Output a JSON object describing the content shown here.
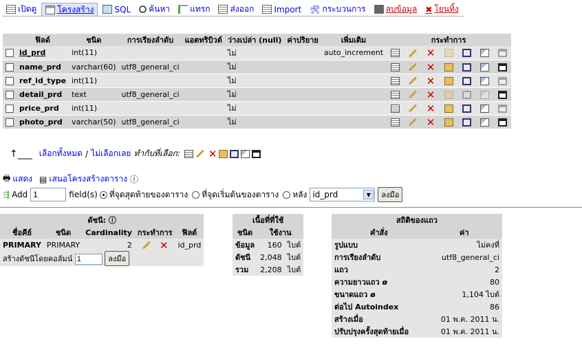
{
  "tabs": [
    {
      "label": "เปิดดู",
      "icon": "browse-icon"
    },
    {
      "label": "โครงสร้าง",
      "icon": "structure-icon",
      "active": true
    },
    {
      "label": "SQL",
      "icon": "sql-icon"
    },
    {
      "label": "ค้นหา",
      "icon": "search-icon"
    },
    {
      "label": "แทรก",
      "icon": "insert-icon"
    },
    {
      "label": "ส่งออก",
      "icon": "export-icon"
    },
    {
      "label": "Import",
      "icon": "import-icon"
    },
    {
      "label": "กระบวนการ",
      "icon": "operations-icon"
    },
    {
      "label": "ลบข้อมูล",
      "icon": "empty-icon",
      "warn": true
    },
    {
      "label": "โยนทิ้ง",
      "icon": "drop-icon",
      "warn": true
    }
  ],
  "fields_table": {
    "headers": [
      "ฟิลด์",
      "ชนิด",
      "การเรียงลำดับ",
      "แอตทริบิวต์",
      "ว่างเปล่า (null)",
      "ค่าปริยาย",
      "เพิ่มเติม",
      "กระทำการ"
    ],
    "rows": [
      {
        "name": "id_prd",
        "type": "int(11)",
        "collation": "",
        "attributes": "",
        "null": "ไม่",
        "default": "",
        "extra": "auto_increment",
        "primary": true
      },
      {
        "name": "name_prd",
        "type": "varchar(60)",
        "collation": "utf8_general_ci",
        "attributes": "",
        "null": "ไม่",
        "default": "",
        "extra": ""
      },
      {
        "name": "ref_id_type",
        "type": "int(11)",
        "collation": "",
        "attributes": "",
        "null": "ไม่",
        "default": "",
        "extra": ""
      },
      {
        "name": "detail_prd",
        "type": "text",
        "collation": "utf8_general_ci",
        "attributes": "",
        "null": "ไม่",
        "default": "",
        "extra": ""
      },
      {
        "name": "price_prd",
        "type": "int(11)",
        "collation": "",
        "attributes": "",
        "null": "ไม่",
        "default": "",
        "extra": ""
      },
      {
        "name": "photo_prd",
        "type": "varchar(50)",
        "collation": "utf8_general_ci",
        "attributes": "",
        "null": "ไม่",
        "default": "",
        "extra": ""
      }
    ]
  },
  "check_all": {
    "select_all": "เลือกทั้งหมด",
    "separator": "/",
    "deselect_all": "ไม่เลือกเลย",
    "with_selected": "ทำกับที่เลือก:"
  },
  "links": {
    "print_view": "แสดง",
    "propose_structure": "เสนอโครงสร้างตาราง"
  },
  "add_field": {
    "add_label": "Add",
    "count": "1",
    "fields_label": "field(s)",
    "at_end": "ที่จุดสุดท้ายของตาราง",
    "at_begin": "ที่จุดเริ่มต้นของตาราง",
    "after": "หลัง",
    "after_field": "id_prd",
    "go": "ลงมือ"
  },
  "indexes": {
    "title": "ดัชนี:",
    "headers": [
      "ชื่อคีย์",
      "ชนิด",
      "Cardinality",
      "กระทำการ",
      "ฟิลด์"
    ],
    "row": {
      "keyname": "PRIMARY",
      "type": "PRIMARY",
      "cardinality": "2",
      "field": "id_prd"
    },
    "create_label": "สร้างดัชนีโดยคอลัมน์",
    "create_count": "1",
    "go": "ลงมือ"
  },
  "space_usage": {
    "title": "เนื้อที่ที่ใช้",
    "headers": [
      "ชนิด",
      "ใช้งาน"
    ],
    "rows": [
      {
        "label": "ข้อมูล",
        "value": "160",
        "unit": "ไบต์"
      },
      {
        "label": "ดัชนี",
        "value": "2,048",
        "unit": "ไบต์"
      },
      {
        "label": "รวม",
        "value": "2,208",
        "unit": "ไบต์"
      }
    ]
  },
  "row_stats": {
    "title": "สถิติของแถว",
    "headers": [
      "คำสั่ง",
      "ค่า"
    ],
    "rows": [
      {
        "label": "รูปแบบ",
        "value": "ไม่คงที่"
      },
      {
        "label": "การเรียงลำดับ",
        "value": "utf8_general_ci"
      },
      {
        "label": "แถว",
        "value": "2"
      },
      {
        "label": "ความยาวแถว ø",
        "value": "80"
      },
      {
        "label": "ขนาดแถว ø",
        "value": "1,104 ไบต์"
      },
      {
        "label": "ต่อไป Autoindex",
        "value": "86"
      },
      {
        "label": "สร้างเมื่อ",
        "value": "01 พ.ค. 2011 น."
      },
      {
        "label": "ปรับปรุงครั้งสุดท้ายเมื่อ",
        "value": "01 พ.ค. 2011 น."
      }
    ]
  },
  "colors": {
    "link": "#0000ee",
    "warn": "#cc0000",
    "row_odd": "#e5e5e5",
    "row_even": "#d5d5d5",
    "header": "#d5d5d5"
  }
}
